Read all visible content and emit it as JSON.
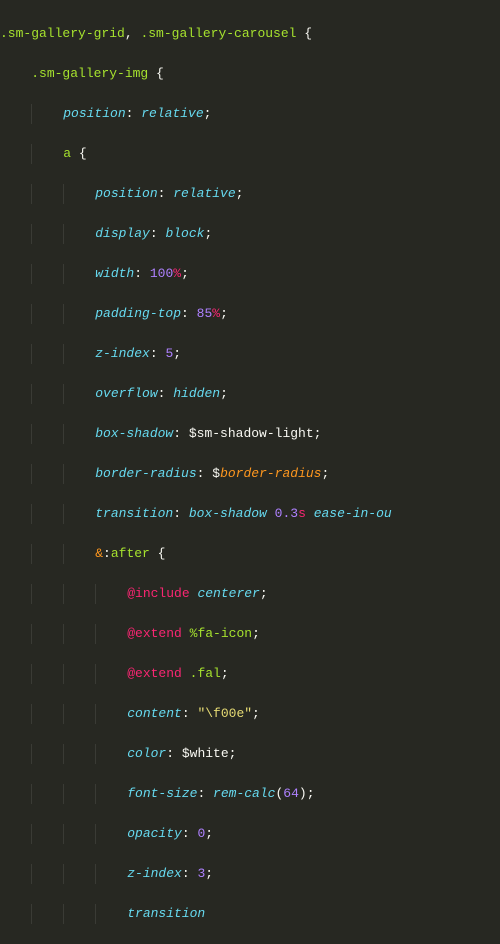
{
  "l1": {
    "sel1": ".sm-gallery-grid",
    "comma": ", ",
    "sel2": ".sm-gallery-carousel",
    "brace": " {"
  },
  "l2": {
    "sel": ".sm-gallery-img",
    "brace": " {"
  },
  "l3": {
    "prop": "position",
    "val": "relative"
  },
  "l4": {
    "sel": "a",
    "brace": " {"
  },
  "l5": {
    "prop": "position",
    "val": "relative"
  },
  "l6": {
    "prop": "display",
    "val": "block"
  },
  "l7": {
    "prop": "width",
    "num": "100",
    "unit": "%"
  },
  "l8": {
    "prop": "padding-top",
    "num": "85",
    "unit": "%"
  },
  "l9": {
    "prop": "z-index",
    "num": "5"
  },
  "l10": {
    "prop": "overflow",
    "val": "hidden"
  },
  "l11": {
    "prop": "box-shadow",
    "var": "$sm-shadow-light"
  },
  "l12": {
    "prop": "border-radius",
    "var": "$",
    "varname": "border-radius"
  },
  "l13": {
    "prop": "transition",
    "v1": "box-shadow",
    "num": "0.3",
    "unit": "s",
    "v2": "ease-in-ou"
  },
  "l14": {
    "amp": "&",
    "colon": ":",
    "pseudo": "after",
    "brace": " {"
  },
  "l15": {
    "kw": "@include",
    "name": "centerer"
  },
  "l16": {
    "kw": "@extend",
    "name": "%fa-icon"
  },
  "l17": {
    "kw": "@extend",
    "name": ".fal"
  },
  "l18": {
    "prop": "content",
    "str": "\"\\f00e\""
  },
  "l19": {
    "prop": "color",
    "var": "$white"
  },
  "l20": {
    "prop": "font-size",
    "func": "rem-calc",
    "arg": "64"
  },
  "l21": {
    "prop": "opacity",
    "num": "0"
  },
  "l22": {
    "prop": "z-index",
    "num": "3"
  },
  "l23": {
    "prop": "transition"
  }
}
